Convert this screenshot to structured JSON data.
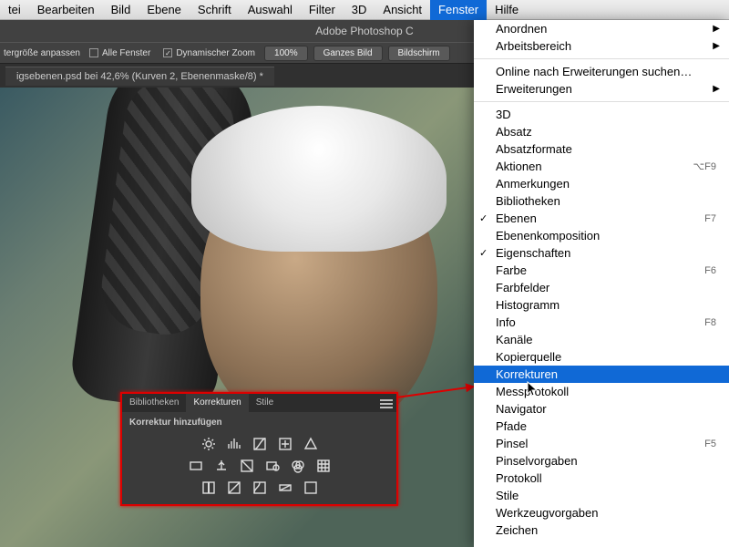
{
  "menubar": {
    "items": [
      "tei",
      "Bearbeiten",
      "Bild",
      "Ebene",
      "Schrift",
      "Auswahl",
      "Filter",
      "3D",
      "Ansicht",
      "Fenster",
      "Hilfe"
    ],
    "open_index": 9
  },
  "app_title": "Adobe Photoshop C",
  "options": {
    "resize_label": "tergröße anpassen",
    "all_windows": "Alle Fenster",
    "dyn_zoom": "Dynamischer Zoom",
    "zoom_value": "100%",
    "fit_screen": "Ganzes Bild",
    "fill_screen": "Bildschirm"
  },
  "doc_tab": "igsebenen.psd bei 42,6% (Kurven 2, Ebenenmaske/8) *",
  "adjust_panel": {
    "tabs": [
      "Bibliotheken",
      "Korrekturen",
      "Stile"
    ],
    "active_tab": 1,
    "heading": "Korrektur hinzufügen"
  },
  "window_menu": [
    {
      "label": "Anordnen",
      "submenu": true
    },
    {
      "label": "Arbeitsbereich",
      "submenu": true
    },
    {
      "sep": true
    },
    {
      "label": "Online nach Erweiterungen suchen…"
    },
    {
      "label": "Erweiterungen",
      "submenu": true
    },
    {
      "sep": true
    },
    {
      "label": "3D"
    },
    {
      "label": "Absatz"
    },
    {
      "label": "Absatzformate"
    },
    {
      "label": "Aktionen",
      "shortcut": "⌥F9"
    },
    {
      "label": "Anmerkungen"
    },
    {
      "label": "Bibliotheken"
    },
    {
      "label": "Ebenen",
      "checked": true,
      "shortcut": "F7"
    },
    {
      "label": "Ebenenkomposition"
    },
    {
      "label": "Eigenschaften",
      "checked": true
    },
    {
      "label": "Farbe",
      "shortcut": "F6"
    },
    {
      "label": "Farbfelder"
    },
    {
      "label": "Histogramm"
    },
    {
      "label": "Info",
      "shortcut": "F8"
    },
    {
      "label": "Kanäle"
    },
    {
      "label": "Kopierquelle"
    },
    {
      "label": "Korrekturen",
      "highlight": true
    },
    {
      "label": "Messprotokoll"
    },
    {
      "label": "Navigator"
    },
    {
      "label": "Pfade"
    },
    {
      "label": "Pinsel",
      "shortcut": "F5"
    },
    {
      "label": "Pinselvorgaben"
    },
    {
      "label": "Protokoll"
    },
    {
      "label": "Stile"
    },
    {
      "label": "Werkzeugvorgaben"
    },
    {
      "label": "Zeichen"
    }
  ]
}
